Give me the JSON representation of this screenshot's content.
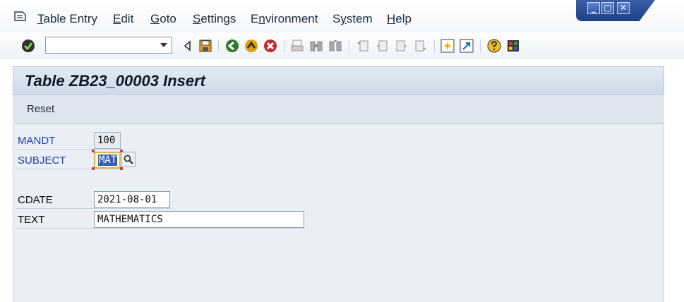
{
  "menubar": {
    "items": [
      {
        "pre": "",
        "ul": "T",
        "post": "able Entry"
      },
      {
        "pre": "",
        "ul": "E",
        "post": "dit"
      },
      {
        "pre": "",
        "ul": "G",
        "post": "oto"
      },
      {
        "pre": "",
        "ul": "S",
        "post": "ettings"
      },
      {
        "pre": "E",
        "ul": "n",
        "post": "vironment"
      },
      {
        "pre": "S",
        "ul": "y",
        "post": "stem"
      },
      {
        "pre": "",
        "ul": "H",
        "post": "elp"
      }
    ],
    "window_controls": [
      "_",
      "□",
      "✕"
    ]
  },
  "toolbar": {
    "command_field_value": "",
    "icons": [
      "enter-icon",
      "back-arrow-icon",
      "save-icon",
      "back-icon",
      "exit-icon",
      "cancel-icon",
      "print-icon",
      "find-icon",
      "find-next-icon",
      "first-page-icon",
      "previous-page-icon",
      "next-page-icon",
      "last-page-icon",
      "create-session-icon",
      "shortcut-icon",
      "help-icon",
      "customize-layout-icon"
    ]
  },
  "screen": {
    "title": "Table ZB23_00003 Insert",
    "app_toolbar": {
      "reset_label": "Reset"
    }
  },
  "form": {
    "mandt": {
      "label": "MANDT",
      "value": "100"
    },
    "subject": {
      "label": "SUBJECT",
      "value": "MAT"
    },
    "cdate": {
      "label": "CDATE",
      "value": "2021-08-01"
    },
    "text": {
      "label": "TEXT",
      "value": "MATHEMATICS"
    }
  },
  "colors": {
    "key_label": "#1f3fb4",
    "panel_bg": "#e9eff5",
    "focus_bg": "#fff8c6"
  }
}
